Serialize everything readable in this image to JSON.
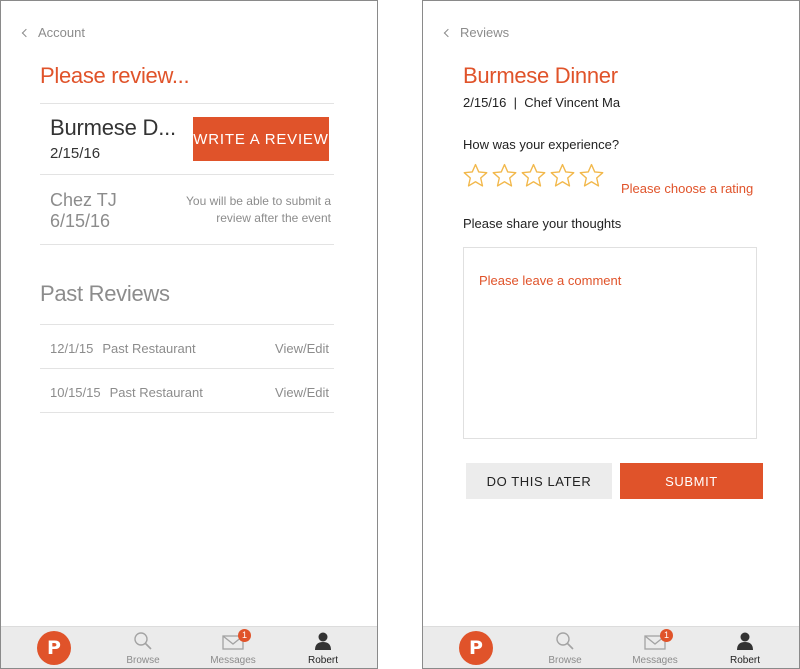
{
  "left": {
    "back_label": "Account",
    "heading": "Please review...",
    "pending": [
      {
        "name": "Burmese D...",
        "date": "2/15/16",
        "action": "WRITE A REVIEW"
      },
      {
        "name": "Chez TJ",
        "date": "6/15/16",
        "note": "You will be able to submit a review after the event"
      }
    ],
    "past_heading": "Past Reviews",
    "past": [
      {
        "date": "12/1/15",
        "restaurant": "Past Restaurant",
        "action": "View/Edit"
      },
      {
        "date": "10/15/15",
        "restaurant": "Past Restaurant",
        "action": "View/Edit"
      }
    ]
  },
  "right": {
    "back_label": "Reviews",
    "title": "Burmese Dinner",
    "subtitle": "2/15/16  |  Chef Vincent Ma",
    "experience_question": "How was your experience?",
    "stars_total": 5,
    "rating_value": 0,
    "rating_hint": "Please choose a rating",
    "thoughts_label": "Please share your thoughts",
    "comment_placeholder": "Please leave a comment",
    "later_label": "DO THIS LATER",
    "submit_label": "SUBMIT"
  },
  "tabbar": {
    "logo_letter": "P",
    "browse_label": "Browse",
    "messages_label": "Messages",
    "messages_badge": "1",
    "profile_label": "Robert"
  },
  "colors": {
    "accent": "#e0532a",
    "star": "#f2b84b",
    "muted": "#8c8c8c"
  },
  "icons": [
    "chevron-left-icon",
    "magnifier-icon",
    "envelope-icon",
    "person-icon",
    "star-icon",
    "logo-p-icon"
  ]
}
